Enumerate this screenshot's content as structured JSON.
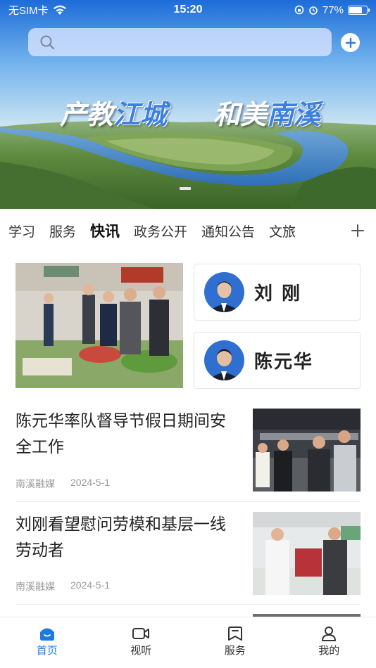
{
  "status_bar": {
    "carrier": "无SIM卡",
    "time": "15:20",
    "battery_percent": "77%",
    "battery_level": 0.77
  },
  "search": {
    "placeholder": ""
  },
  "banner": {
    "slogan_left_a": "产教",
    "slogan_left_b": "江城",
    "slogan_right_a": "和美",
    "slogan_right_b": "南溪"
  },
  "tabs": [
    {
      "label": "学习",
      "active": false
    },
    {
      "label": "服务",
      "active": false
    },
    {
      "label": "快讯",
      "active": true
    },
    {
      "label": "政务公开",
      "active": false
    },
    {
      "label": "通知公告",
      "active": false
    },
    {
      "label": "文旅",
      "active": false
    }
  ],
  "leaders": [
    {
      "name": "刘 刚"
    },
    {
      "name": "陈元华"
    }
  ],
  "news": [
    {
      "title": "陈元华率队督导节假日期间安全工作",
      "source": "南溪融媒",
      "date": "2024-5-1"
    },
    {
      "title": "刘刚看望慰问劳模和基层一线劳动者",
      "source": "南溪融媒",
      "date": "2024-5-1"
    }
  ],
  "bottom_nav": [
    {
      "label": "首页",
      "icon": "home-icon",
      "active": true
    },
    {
      "label": "视听",
      "icon": "video-icon",
      "active": false
    },
    {
      "label": "服务",
      "icon": "bookmark-icon",
      "active": false
    },
    {
      "label": "我的",
      "icon": "user-icon",
      "active": false
    }
  ],
  "colors": {
    "accent": "#1f7ae0",
    "text": "#222222",
    "meta": "#9a9a9a"
  }
}
